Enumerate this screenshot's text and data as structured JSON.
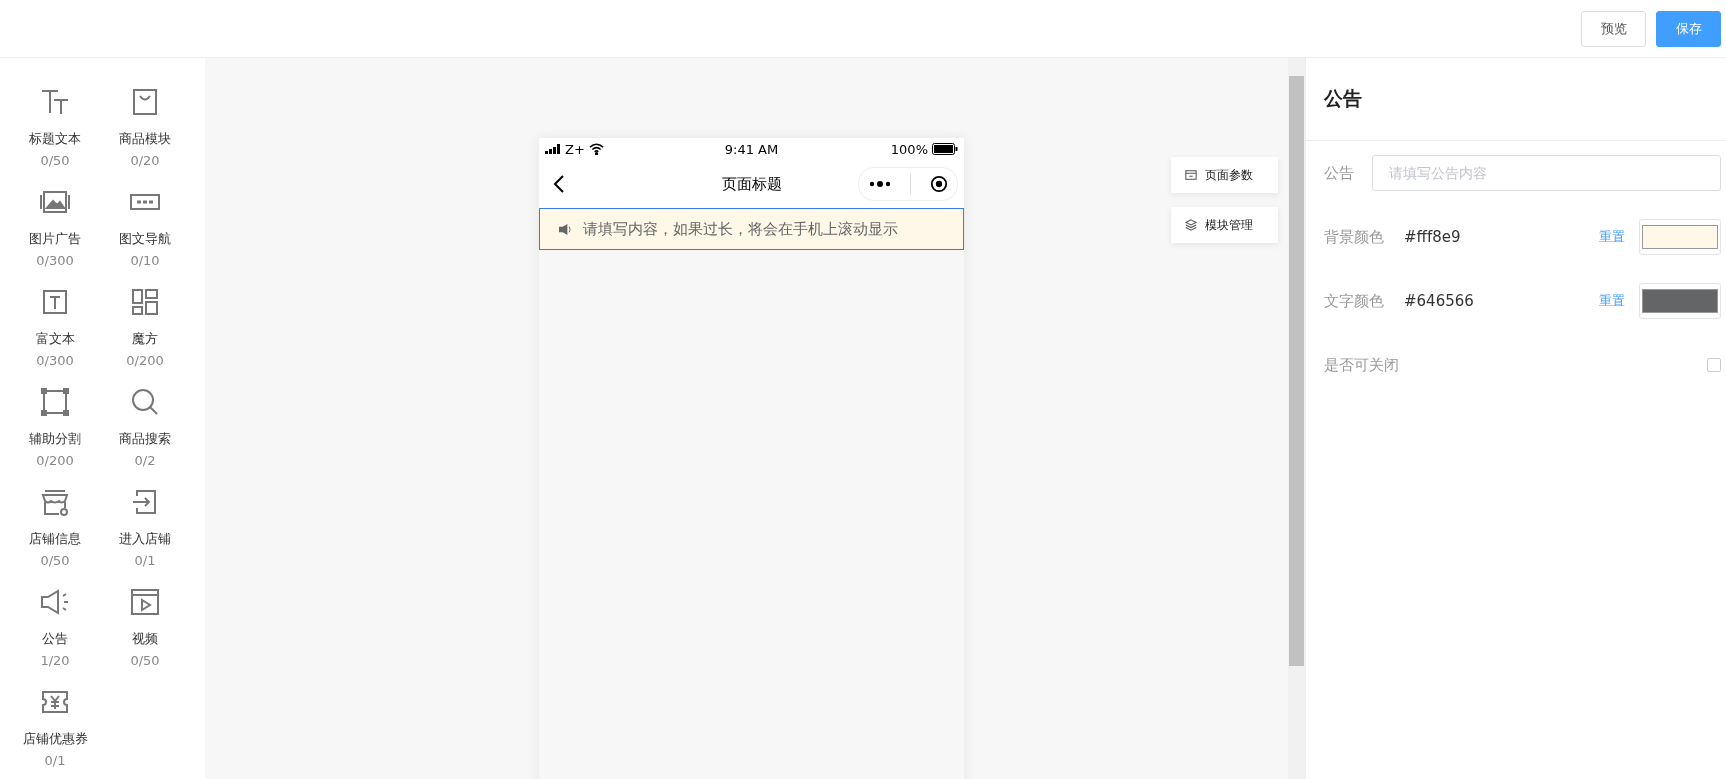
{
  "header": {
    "buttons": [
      {
        "label": "预览",
        "kind": "default"
      },
      {
        "label": "保存",
        "kind": "primary"
      }
    ]
  },
  "components": [
    {
      "kind": "title",
      "name": "标题文本",
      "count": "0/50"
    },
    {
      "kind": "bag",
      "name": "商品模块",
      "count": "0/20"
    },
    {
      "kind": "image",
      "name": "图片广告",
      "count": "0/300"
    },
    {
      "kind": "nav",
      "name": "图文导航",
      "count": "0/10"
    },
    {
      "kind": "richtext",
      "name": "富文本",
      "count": "0/300"
    },
    {
      "kind": "cube",
      "name": "魔方",
      "count": "0/200"
    },
    {
      "kind": "divider",
      "name": "辅助分割",
      "count": "0/200"
    },
    {
      "kind": "search",
      "name": "商品搜索",
      "count": "0/2"
    },
    {
      "kind": "store",
      "name": "店铺信息",
      "count": "0/50"
    },
    {
      "kind": "enter",
      "name": "进入店铺",
      "count": "0/1"
    },
    {
      "kind": "notice",
      "name": "公告",
      "count": "1/20"
    },
    {
      "kind": "video",
      "name": "视频",
      "count": "0/50"
    },
    {
      "kind": "coupon",
      "name": "店铺优惠券",
      "count": "0/1"
    }
  ],
  "phone": {
    "carrier": "Z+",
    "time": "9:41 AM",
    "battery": "100%",
    "title": "页面标题",
    "notice": {
      "text": "请填写内容，如果过长，将会在手机上滚动显示",
      "selected": true
    }
  },
  "side_buttons": [
    {
      "kind": "page",
      "label": "页面参数"
    },
    {
      "kind": "layers",
      "label": "模块管理"
    }
  ],
  "panel": {
    "title": "公告",
    "notice_field": {
      "label": "公告",
      "placeholder": "请填写公告内容"
    },
    "colors": [
      {
        "label": "背景颜色",
        "value": "#fff8e9",
        "reset": "重置"
      },
      {
        "label": "文字颜色",
        "value": "#646566",
        "reset": "重置"
      }
    ],
    "closable": {
      "label": "是否可关闭",
      "checked": false
    }
  }
}
